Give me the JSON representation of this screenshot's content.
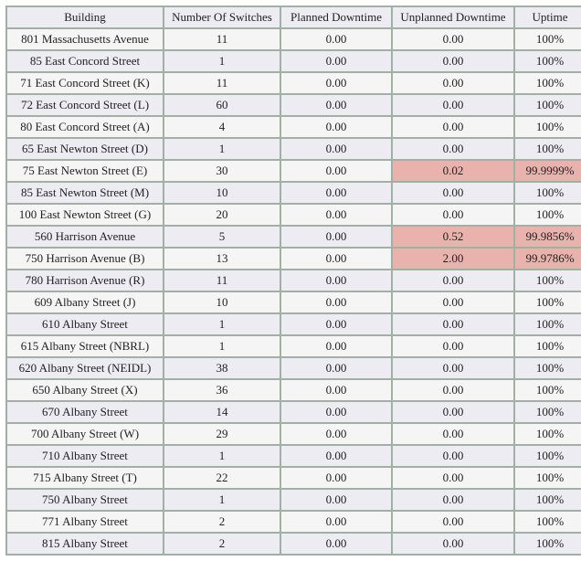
{
  "headers": {
    "building": "Building",
    "switches": "Number Of Switches",
    "planned": "Planned Downtime",
    "unplanned": "Unplanned Downtime",
    "uptime": "Uptime"
  },
  "rows": [
    {
      "building": "801 Massachusetts Avenue",
      "switches": "11",
      "planned": "0.00",
      "unplanned": "0.00",
      "uptime": "100%",
      "flag": false
    },
    {
      "building": "85 East Concord Street",
      "switches": "1",
      "planned": "0.00",
      "unplanned": "0.00",
      "uptime": "100%",
      "flag": false
    },
    {
      "building": "71 East Concord Street (K)",
      "switches": "11",
      "planned": "0.00",
      "unplanned": "0.00",
      "uptime": "100%",
      "flag": false
    },
    {
      "building": "72 East Concord Street (L)",
      "switches": "60",
      "planned": "0.00",
      "unplanned": "0.00",
      "uptime": "100%",
      "flag": false
    },
    {
      "building": "80 East Concord Street (A)",
      "switches": "4",
      "planned": "0.00",
      "unplanned": "0.00",
      "uptime": "100%",
      "flag": false
    },
    {
      "building": "65 East Newton Street (D)",
      "switches": "1",
      "planned": "0.00",
      "unplanned": "0.00",
      "uptime": "100%",
      "flag": false
    },
    {
      "building": "75 East Newton Street (E)",
      "switches": "30",
      "planned": "0.00",
      "unplanned": "0.02",
      "uptime": "99.9999%",
      "flag": true
    },
    {
      "building": "85 East Newton Street (M)",
      "switches": "10",
      "planned": "0.00",
      "unplanned": "0.00",
      "uptime": "100%",
      "flag": false
    },
    {
      "building": "100 East Newton Street (G)",
      "switches": "20",
      "planned": "0.00",
      "unplanned": "0.00",
      "uptime": "100%",
      "flag": false
    },
    {
      "building": "560 Harrison Avenue",
      "switches": "5",
      "planned": "0.00",
      "unplanned": "0.52",
      "uptime": "99.9856%",
      "flag": true
    },
    {
      "building": "750 Harrison Avenue (B)",
      "switches": "13",
      "planned": "0.00",
      "unplanned": "2.00",
      "uptime": "99.9786%",
      "flag": true
    },
    {
      "building": "780 Harrison Avenue (R)",
      "switches": "11",
      "planned": "0.00",
      "unplanned": "0.00",
      "uptime": "100%",
      "flag": false
    },
    {
      "building": "609 Albany Street (J)",
      "switches": "10",
      "planned": "0.00",
      "unplanned": "0.00",
      "uptime": "100%",
      "flag": false
    },
    {
      "building": "610 Albany Street",
      "switches": "1",
      "planned": "0.00",
      "unplanned": "0.00",
      "uptime": "100%",
      "flag": false
    },
    {
      "building": "615 Albany Street (NBRL)",
      "switches": "1",
      "planned": "0.00",
      "unplanned": "0.00",
      "uptime": "100%",
      "flag": false
    },
    {
      "building": "620 Albany Street (NEIDL)",
      "switches": "38",
      "planned": "0.00",
      "unplanned": "0.00",
      "uptime": "100%",
      "flag": false
    },
    {
      "building": "650 Albany Street (X)",
      "switches": "36",
      "planned": "0.00",
      "unplanned": "0.00",
      "uptime": "100%",
      "flag": false
    },
    {
      "building": "670 Albany Street",
      "switches": "14",
      "planned": "0.00",
      "unplanned": "0.00",
      "uptime": "100%",
      "flag": false
    },
    {
      "building": "700 Albany Street (W)",
      "switches": "29",
      "planned": "0.00",
      "unplanned": "0.00",
      "uptime": "100%",
      "flag": false
    },
    {
      "building": "710 Albany Street",
      "switches": "1",
      "planned": "0.00",
      "unplanned": "0.00",
      "uptime": "100%",
      "flag": false
    },
    {
      "building": "715 Albany Street (T)",
      "switches": "22",
      "planned": "0.00",
      "unplanned": "0.00",
      "uptime": "100%",
      "flag": false
    },
    {
      "building": "750 Albany Street",
      "switches": "1",
      "planned": "0.00",
      "unplanned": "0.00",
      "uptime": "100%",
      "flag": false
    },
    {
      "building": "771 Albany Street",
      "switches": "2",
      "planned": "0.00",
      "unplanned": "0.00",
      "uptime": "100%",
      "flag": false
    },
    {
      "building": "815 Albany Street",
      "switches": "2",
      "planned": "0.00",
      "unplanned": "0.00",
      "uptime": "100%",
      "flag": false
    }
  ]
}
